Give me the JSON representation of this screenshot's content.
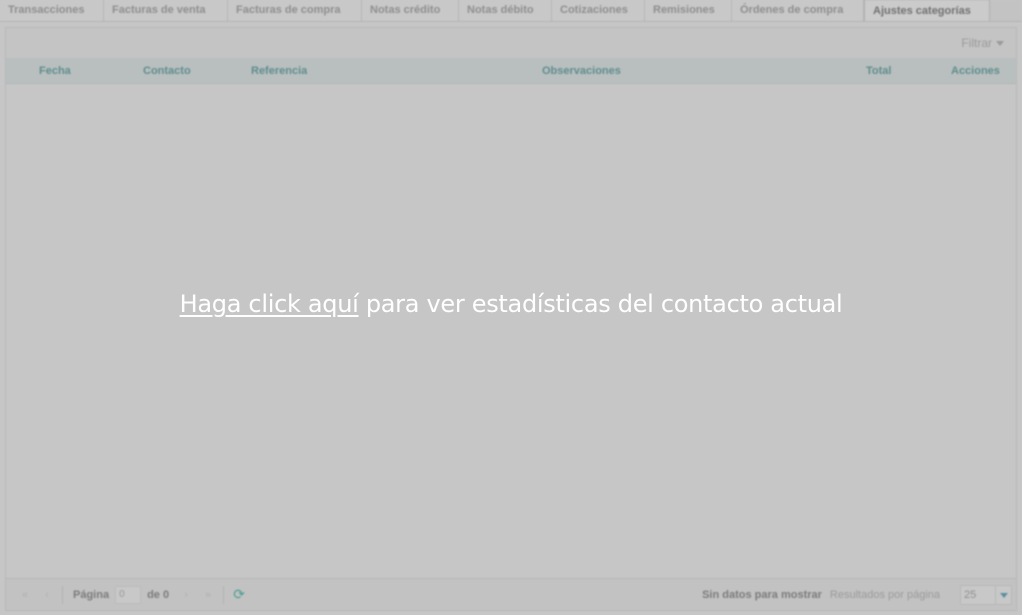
{
  "tabs": [
    {
      "label": "Transacciones",
      "active": false
    },
    {
      "label": "Facturas de venta",
      "active": false
    },
    {
      "label": "Facturas de compra",
      "active": false
    },
    {
      "label": "Notas crédito",
      "active": false
    },
    {
      "label": "Notas débito",
      "active": false
    },
    {
      "label": "Cotizaciones",
      "active": false
    },
    {
      "label": "Remisiones",
      "active": false
    },
    {
      "label": "Órdenes de compra",
      "active": false
    },
    {
      "label": "Ajustes categorías",
      "active": true
    }
  ],
  "toolbar": {
    "filter_label": "Filtrar"
  },
  "grid": {
    "columns": [
      "Fecha",
      "Contacto",
      "Referencia",
      "Observaciones",
      "Total",
      "Acciones"
    ]
  },
  "pager": {
    "page_label": "Página",
    "page_value": "0",
    "of_label": "de 0",
    "no_data": "Sin datos para mostrar",
    "per_page_label": "Resultados por página",
    "per_page_value": "25"
  },
  "overlay": {
    "link_text": "Haga click aquí",
    "rest_text": " para ver estadísticas del contacto actual"
  },
  "colors": {
    "header_text": "#5f8c8c",
    "refresh_icon": "#4a9e8f",
    "overlay_text": "#ffffff"
  }
}
